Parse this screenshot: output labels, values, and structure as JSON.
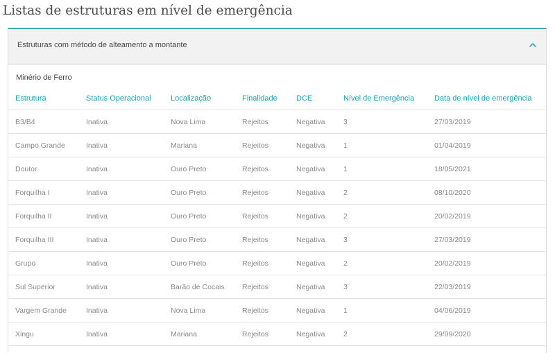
{
  "page": {
    "title": "Listas de estruturas em nível de emergência"
  },
  "panel": {
    "header_label": "Estruturas com método de alteamento a montante",
    "toggle_icon": "chevron-up-icon",
    "accent_color": "#3aa9b4"
  },
  "group": {
    "label": "Minério de Ferro"
  },
  "table": {
    "header_color": "#1aa3b5",
    "columns": [
      "Estrutura",
      "Status Operacional",
      "Localização",
      "Finalidade",
      "DCE",
      "Nível de Emergência",
      "Data de nível de emergência"
    ],
    "rows": [
      [
        "B3/B4",
        "Inativa",
        "Nova Lima",
        "Rejeitos",
        "Negativa",
        "3",
        "27/03/2019"
      ],
      [
        "Campo Grande",
        "Inativa",
        "Mariana",
        "Rejeitos",
        "Negativa",
        "1",
        "01/04/2019"
      ],
      [
        "Doutor",
        "Inativa",
        "Ouro Preto",
        "Rejeitos",
        "Negativa",
        "1",
        "18/05/2021"
      ],
      [
        "Forquilha I",
        "Inativa",
        "Ouro Preto",
        "Rejeitos",
        "Negativa",
        "2",
        "08/10/2020"
      ],
      [
        "Forquilha II",
        "Inativa",
        "Ouro Preto",
        "Rejeitos",
        "Negativa",
        "2",
        "20/02/2019"
      ],
      [
        "Forquilha III",
        "Inativa",
        "Ouro Preto",
        "Rejeitos",
        "Negativa",
        "3",
        "27/03/2019"
      ],
      [
        "Grupo",
        "Inativa",
        "Ouro Preto",
        "Rejeitos",
        "Negativa",
        "2",
        "20/02/2019"
      ],
      [
        "Sul Superior",
        "Inativa",
        "Barão de Cocais",
        "Rejeitos",
        "Negativa",
        "3",
        "22/03/2019"
      ],
      [
        "Vargem Grande",
        "Inativa",
        "Nova Lima",
        "Rejeitos",
        "Negativa",
        "1",
        "04/06/2019"
      ],
      [
        "Xingu",
        "Inativa",
        "Mariana",
        "Rejeitos",
        "Negativa",
        "2",
        "29/09/2020"
      ]
    ]
  }
}
